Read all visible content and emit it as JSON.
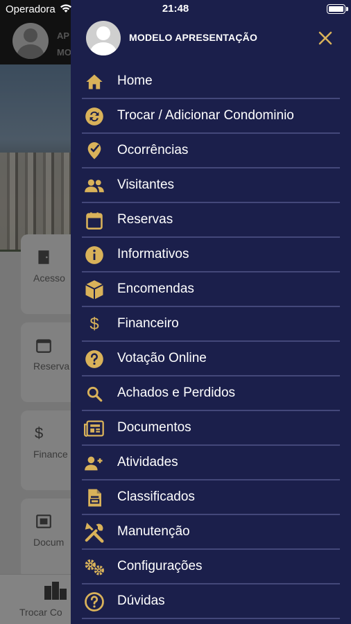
{
  "status_bar": {
    "carrier": "Operadora",
    "time": "21:48"
  },
  "background": {
    "header_line1": "AP",
    "header_line2": "MO",
    "cards": [
      "Acesso",
      "Reserva",
      "Finance",
      "Docum"
    ],
    "bottom_label": "Trocar Co"
  },
  "drawer": {
    "profile_name": "MODELO APRESENTAÇÃO",
    "accent_color": "#d9b25a",
    "background_color": "#1b1f4b",
    "items": [
      {
        "label": "Home",
        "icon": "home-icon"
      },
      {
        "label": "Trocar / Adicionar Condominio",
        "icon": "swap-icon"
      },
      {
        "label": "Ocorrências",
        "icon": "badge-check-icon"
      },
      {
        "label": "Visitantes",
        "icon": "people-icon"
      },
      {
        "label": "Reservas",
        "icon": "calendar-icon"
      },
      {
        "label": "Informativos",
        "icon": "info-icon"
      },
      {
        "label": "Encomendas",
        "icon": "package-icon"
      },
      {
        "label": "Financeiro",
        "icon": "dollar-icon"
      },
      {
        "label": "Votação Online",
        "icon": "question-icon"
      },
      {
        "label": "Achados e Perdidos",
        "icon": "search-icon"
      },
      {
        "label": "Documentos",
        "icon": "newspaper-icon"
      },
      {
        "label": "Atividades",
        "icon": "user-plus-icon"
      },
      {
        "label": "Classificados",
        "icon": "clipboard-icon"
      },
      {
        "label": "Manutenção",
        "icon": "tools-icon"
      },
      {
        "label": "Configurações",
        "icon": "gears-icon"
      },
      {
        "label": "Dúvidas",
        "icon": "help-circle-icon"
      }
    ]
  }
}
